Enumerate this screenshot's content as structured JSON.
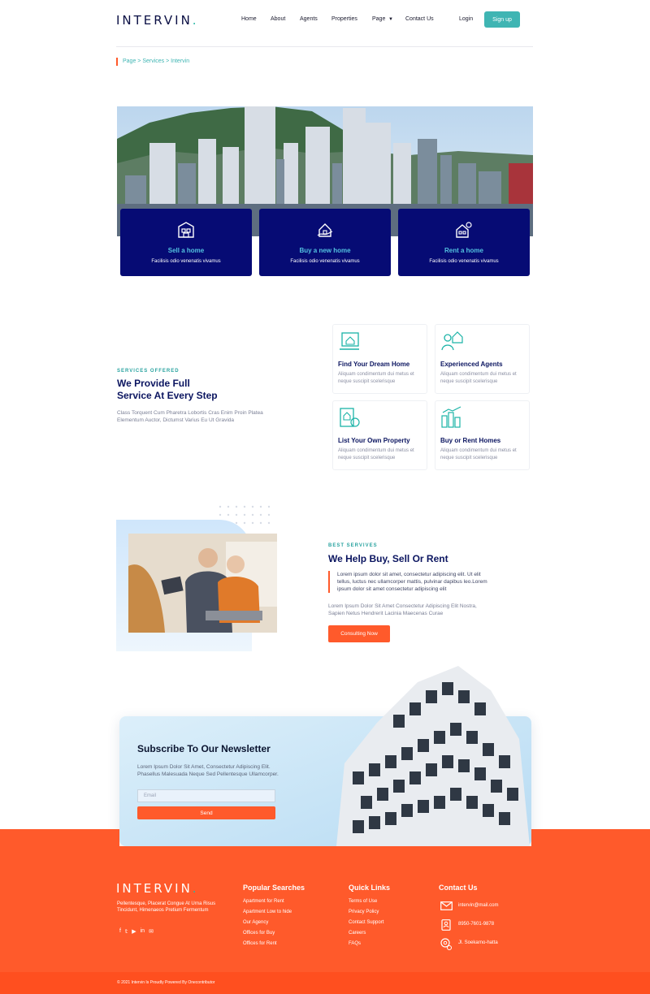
{
  "header": {
    "logo": "INTERVIN",
    "logo_dot": ".",
    "nav": [
      "Home",
      "About",
      "Agents",
      "Properties",
      "Page",
      "Contact Us"
    ],
    "login": "Login",
    "signup": "Sign up"
  },
  "breadcrumb": "Page > Services > Intervin",
  "hero_cards": [
    {
      "icon": "store-icon",
      "title": "Sell a home",
      "sub": "Facilisis odio venenatis vivamus"
    },
    {
      "icon": "house-hand-icon",
      "title": "Buy a new home",
      "sub": "Facilisis odio venenatis vivamus"
    },
    {
      "icon": "home-key-icon",
      "title": "Rent a home",
      "sub": "Facilisis odio venenatis vivamus"
    }
  ],
  "services": {
    "eyebrow": "SERVICES OFFERED",
    "title_line1": "We Provide Full",
    "title_line2": "Service At Every Step",
    "desc": "Class Torquent Cum Pharetra Lobortis Cras Enim Proin Platea Elementum Auctor, Dictumst Varius Eu Ut Gravida",
    "items": [
      {
        "icon": "laptop-house-icon",
        "title": "Find Your Dream Home",
        "desc": "Aliquam condimentum dui metus et neque suscipit scelerisque"
      },
      {
        "icon": "agent-house-icon",
        "title": "Experienced Agents",
        "desc": "Aliquam condimentum dui metus et neque suscipit scelerisque"
      },
      {
        "icon": "listing-board-icon",
        "title": "List Your Own Property",
        "desc": "Aliquam condimentum dui metus et neque suscipit scelerisque"
      },
      {
        "icon": "city-chart-icon",
        "title": "Buy or Rent Homes",
        "desc": "Aliquam condimentum dui metus et neque suscipit scelerisque"
      }
    ]
  },
  "best": {
    "eyebrow": "BEST SERVIVES",
    "title": "We Help Buy, Sell Or Rent",
    "quote": "Lorem ipsum dolor sit amet, consectetur adipiscing elit. Ut elit tellus, luctus nec ullamcorper mattis, pulvinar dapibus leo.Lorem ipsum dolor sit amet consectetur adipiscing elit",
    "para": "Lorem Ipsum Dolor Sit Amet Consectetur Adipiscing Elit Nostra, Sapien Netus Hendrerit Lacinia Maecenas Curae",
    "button": "Consulting Now"
  },
  "newsletter": {
    "title": "Subscribe To Our Newsletter",
    "desc": "Lorem Ipsum Dolor Sit Amet, Consectetur Adipiscing Elit. Phasellus Malesuada Neque Sed Pellentesque Ullamcorper.",
    "placeholder": "Email",
    "button": "Send"
  },
  "footer": {
    "logo": "INTERVIN",
    "tagline": "Pellentesque, Placerat Congue At Urna Risus Tincidunt, Himenaeos Pretium Fermentum",
    "popular_title": "Popular Searches",
    "popular": [
      "Apartment for Rent",
      "Apartment Low to hide",
      "Our Agency",
      "Offices for Buy",
      "Offices for Rent"
    ],
    "quick_title": "Quick Links",
    "quick": [
      "Terms of Use",
      "Privacy Policy",
      "Contact Support",
      "Careers",
      "FAQs"
    ],
    "contact_title": "Contact Us",
    "email": "intervin@mail.com",
    "phone": "8950-7601-9878",
    "address": "Jl. Soekarno-hatta",
    "copyright": "© 2021 Intervin Is Proudly Powered By Onecontributor"
  },
  "colors": {
    "navy": "#060b74",
    "accent": "#ff5a2b",
    "teal": "#3fb5b3"
  }
}
